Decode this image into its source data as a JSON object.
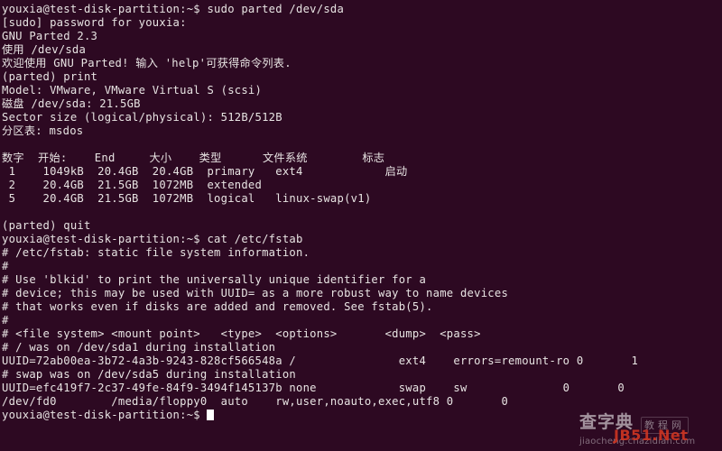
{
  "terminal": {
    "background_color": "#2d0922",
    "text_color": "#e8e4e3",
    "cursor_color": "#ffffff",
    "prompt": "youxia@test-disk-partition:~$",
    "lines": [
      "youxia@test-disk-partition:~$ sudo parted /dev/sda",
      "[sudo] password for youxia:",
      "GNU Parted 2.3",
      "使用 /dev/sda",
      "欢迎使用 GNU Parted! 输入 'help'可获得命令列表.",
      "(parted) print",
      "Model: VMware, VMware Virtual S (scsi)",
      "磁盘 /dev/sda: 21.5GB",
      "Sector size (logical/physical): 512B/512B",
      "分区表: msdos",
      "",
      "数字  开始:    End     大小    类型      文件系统        标志",
      " 1    1049kB  20.4GB  20.4GB  primary   ext4            启动",
      " 2    20.4GB  21.5GB  1072MB  extended",
      " 5    20.4GB  21.5GB  1072MB  logical   linux-swap(v1)",
      "",
      "(parted) quit",
      "youxia@test-disk-partition:~$ cat /etc/fstab",
      "# /etc/fstab: static file system information.",
      "#",
      "# Use 'blkid' to print the universally unique identifier for a",
      "# device; this may be used with UUID= as a more robust way to name devices",
      "# that works even if disks are added and removed. See fstab(5).",
      "#",
      "# <file system> <mount point>   <type>  <options>       <dump>  <pass>",
      "# / was on /dev/sda1 during installation",
      "UUID=72ab00ea-3b72-4a3b-9243-828cf566548a /               ext4    errors=remount-ro 0       1",
      "# swap was on /dev/sda5 during installation",
      "UUID=efc419f7-2c37-49fe-84f9-3494f145137b none            swap    sw              0       0",
      "/dev/fd0        /media/floppy0  auto    rw,user,noauto,exec,utf8 0       0"
    ],
    "final_prompt": "youxia@test-disk-partition:~$ "
  },
  "watermark": {
    "brand": "查字典",
    "badge": "教程网",
    "url": "jiaocheng.chazidian.com",
    "overlay": "JB51.Net",
    "overlay_color": "#e23b22"
  }
}
